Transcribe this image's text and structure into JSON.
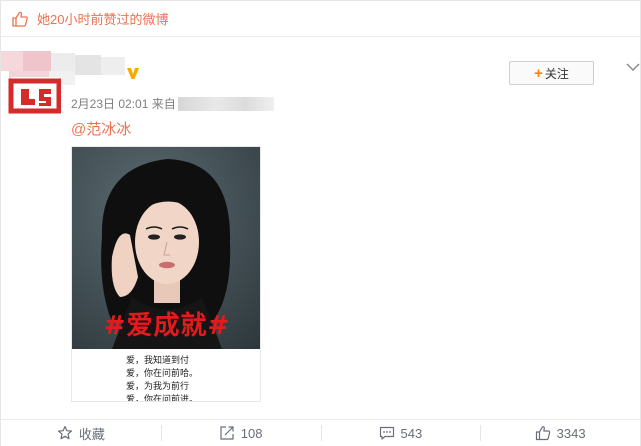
{
  "liked_banner": {
    "icon": "thumbs-up-icon",
    "text": "她20小时前赞过的微博"
  },
  "post": {
    "author_verified_icon": "verified-v-icon",
    "follow_label": "关注",
    "follow_plus": "+",
    "menu_icon": "chevron-down-icon",
    "time": "2月23日 02:01 来自",
    "mention": "@范冰冰",
    "image": {
      "hashtag": "#爱成就#",
      "poem_lines": [
        "爱，我知道到付",
        "爱，你在问前哈。",
        "爱，为我为前行",
        "爱，你在问前进。"
      ]
    }
  },
  "actions": [
    {
      "icon": "star-icon",
      "label": "收藏"
    },
    {
      "icon": "share-icon",
      "label": "108"
    },
    {
      "icon": "comment-icon",
      "label": "543"
    },
    {
      "icon": "like-icon",
      "label": "3343"
    }
  ],
  "colors": {
    "accent": "#eb7350",
    "verified": "#f7ab00",
    "plus": "#ff8200",
    "hashtag_red": "#e21b1b"
  }
}
